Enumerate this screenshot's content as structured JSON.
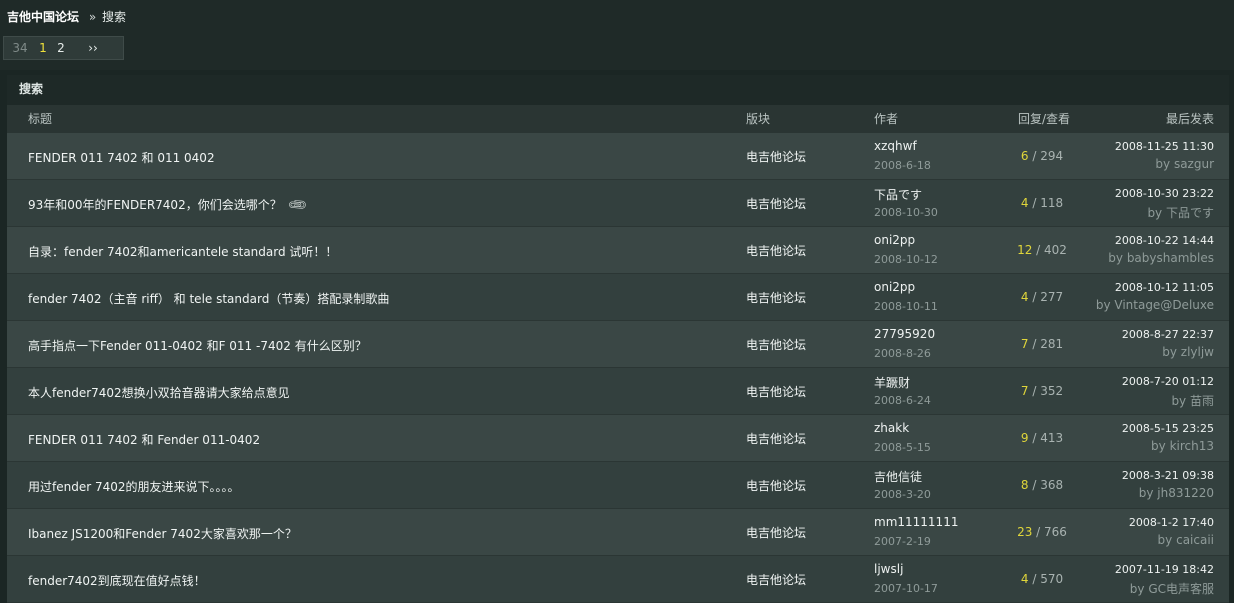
{
  "breadcrumb": {
    "home": "吉他中国论坛",
    "sep": "»",
    "current": "搜索"
  },
  "pager": {
    "total": "34",
    "current": "1",
    "next_page": "2",
    "next": "››"
  },
  "panel": {
    "title": "搜索"
  },
  "columns": {
    "title": "标题",
    "forum": "版块",
    "author": "作者",
    "stats": "回复/查看",
    "last": "最后发表"
  },
  "rows": [
    {
      "title": "FENDER 011 7402 和  011 0402",
      "forum": "电吉他论坛",
      "author": "xzqhwf",
      "date": "2008-6-18",
      "replies": "6",
      "views": "294",
      "last_time": "2008-11-25 11:30",
      "last_by": "sazgur",
      "attach": ""
    },
    {
      "title": "93年和00年的FENDER7402，你们会选哪个？",
      "forum": "电吉他论坛",
      "author": "下品です",
      "date": "2008-10-30",
      "replies": "4",
      "views": "118",
      "last_time": "2008-10-30 23:22",
      "last_by": "下品です",
      "attach": "paperclip-icon"
    },
    {
      "title": "自录：fender 7402和americantele standard 试听！！",
      "forum": "电吉他论坛",
      "author": "oni2pp",
      "date": "2008-10-12",
      "replies": "12",
      "views": "402",
      "last_time": "2008-10-22 14:44",
      "last_by": "babyshambles",
      "attach": ""
    },
    {
      "title": "fender 7402（主音  riff） 和  tele standard（节奏）搭配录制歌曲",
      "forum": "电吉他论坛",
      "author": "oni2pp",
      "date": "2008-10-11",
      "replies": "4",
      "views": "277",
      "last_time": "2008-10-12 11:05",
      "last_by": "Vintage@Deluxe",
      "attach": ""
    },
    {
      "title": "高手指点一下Fender 011-0402 和F 011 -7402 有什么区别？",
      "forum": "电吉他论坛",
      "author": "27795920",
      "date": "2008-8-26",
      "replies": "7",
      "views": "281",
      "last_time": "2008-8-27 22:37",
      "last_by": "zlyljw",
      "attach": ""
    },
    {
      "title": "本人fender7402想换小双拾音器请大家给点意见",
      "forum": "电吉他论坛",
      "author": "羊蹶财",
      "date": "2008-6-24",
      "replies": "7",
      "views": "352",
      "last_time": "2008-7-20 01:12",
      "last_by": "苗雨",
      "attach": ""
    },
    {
      "title": "FENDER 011 7402 和  Fender 011-0402",
      "forum": "电吉他论坛",
      "author": "zhakk",
      "date": "2008-5-15",
      "replies": "9",
      "views": "413",
      "last_time": "2008-5-15 23:25",
      "last_by": "kirch13",
      "attach": ""
    },
    {
      "title": "用过fender 7402的朋友进来说下。。。。",
      "forum": "电吉他论坛",
      "author": "吉他信徒",
      "date": "2008-3-20",
      "replies": "8",
      "views": "368",
      "last_time": "2008-3-21 09:38",
      "last_by": "jh831220",
      "attach": ""
    },
    {
      "title": "Ibanez JS1200和Fender 7402大家喜欢那一个？",
      "forum": "电吉他论坛",
      "author": "mm11111111",
      "date": "2007-2-19",
      "replies": "23",
      "views": "766",
      "last_time": "2008-1-2 17:40",
      "last_by": "caicaii",
      "attach": ""
    },
    {
      "title": "fender7402到底现在值好点钱！",
      "forum": "电吉他论坛",
      "author": "ljwslj",
      "date": "2007-10-17",
      "replies": "4",
      "views": "570",
      "last_time": "2007-11-19 18:42",
      "last_by": "GC电声客服",
      "attach": ""
    }
  ],
  "by_prefix": "by "
}
